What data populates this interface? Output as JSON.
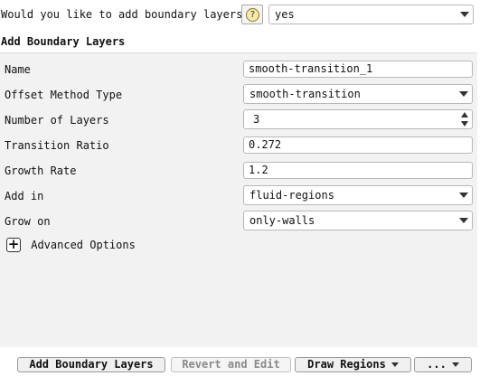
{
  "prompt": {
    "question": "Would you like to add boundary layers?",
    "help_icon": "?",
    "answer": "yes"
  },
  "section": {
    "title": "Add Boundary Layers"
  },
  "fields": {
    "name": {
      "label": "Name",
      "value": "smooth-transition_1"
    },
    "offset_method": {
      "label": "Offset Method Type",
      "value": "smooth-transition"
    },
    "num_layers": {
      "label": "Number of Layers",
      "value": "3"
    },
    "transition_ratio": {
      "label": "Transition Ratio",
      "value": "0.272"
    },
    "growth_rate": {
      "label": "Growth Rate",
      "value": "1.2"
    },
    "add_in": {
      "label": "Add in",
      "value": "fluid-regions"
    },
    "grow_on": {
      "label": "Grow on",
      "value": "only-walls"
    }
  },
  "advanced": {
    "icon": "+",
    "label": "Advanced Options"
  },
  "buttons": {
    "add": "Add Boundary Layers",
    "revert": "Revert and Edit",
    "draw": "Draw Regions",
    "more": "..."
  }
}
